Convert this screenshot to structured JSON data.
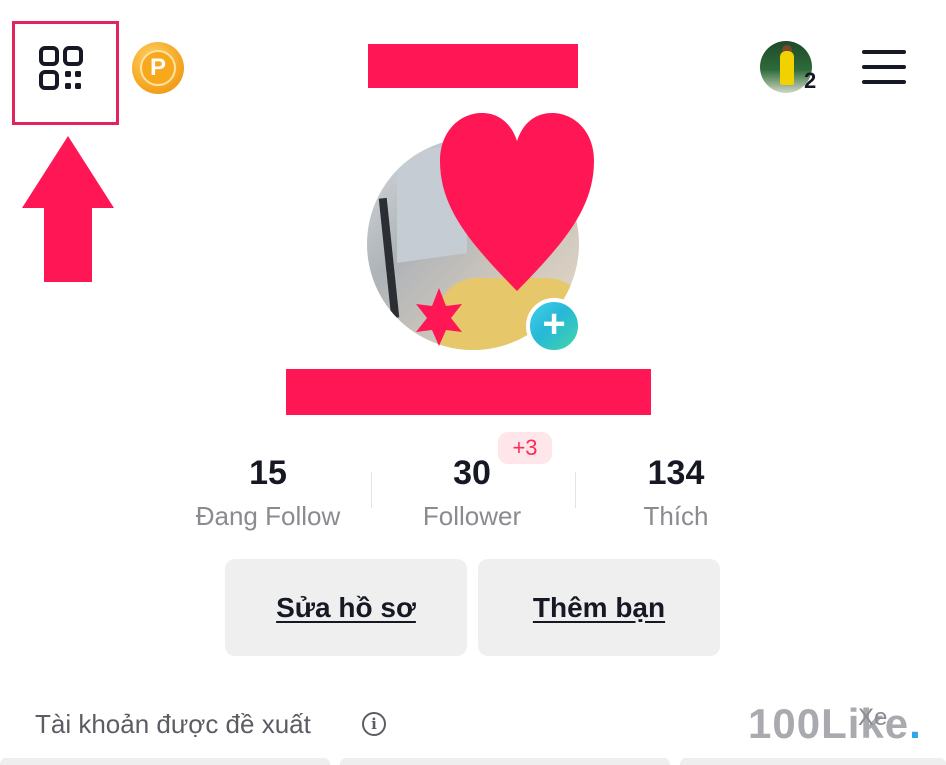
{
  "header": {
    "avatar_badge_count": "2",
    "coin_letter": "P"
  },
  "stats": [
    {
      "value": "15",
      "label": "Đang Follow"
    },
    {
      "value": "30",
      "label": "Follower",
      "badge": "+3"
    },
    {
      "value": "134",
      "label": "Thích"
    }
  ],
  "actions": {
    "edit_profile": "Sửa hồ sơ",
    "add_friends": "Thêm bạn"
  },
  "suggested": {
    "title": "Tài khoản được đề xuất",
    "info_icon_glyph": "i",
    "see_all": "Xe"
  },
  "watermark": {
    "text": "100Like",
    "dot": "."
  },
  "colors": {
    "highlight": "#e0245e",
    "redaction": "#ff1654",
    "accent": "#fe2c55",
    "avatar_plus": "#26b8d8"
  },
  "icons": [
    "qr-code-icon",
    "up-arrow-icon",
    "coin-icon",
    "menu-icon",
    "heart-sticker-icon",
    "star-badge-icon",
    "plus-icon",
    "info-icon"
  ]
}
